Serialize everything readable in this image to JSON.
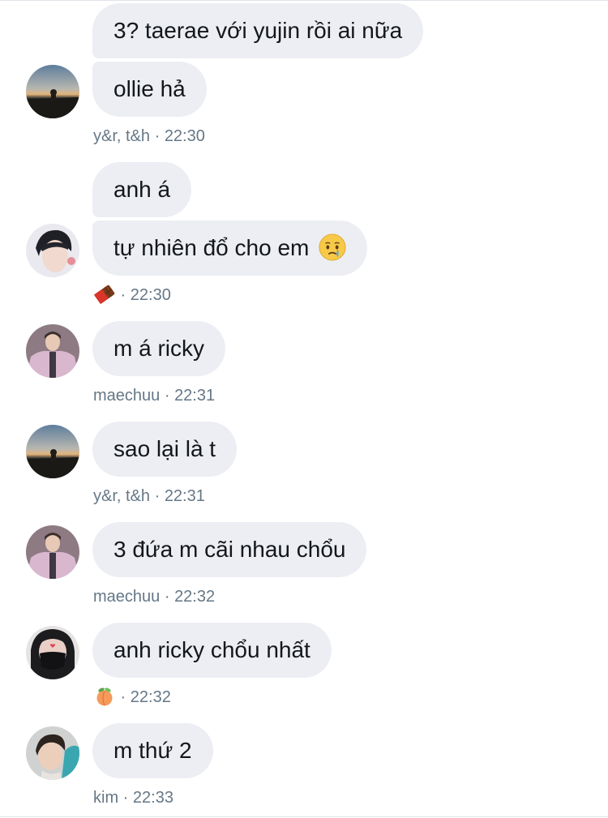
{
  "messages": [
    {
      "text": "3? taerae với yujin rồi ai nữa"
    },
    {
      "text": "ollie hả"
    },
    {
      "text": "anh á"
    },
    {
      "text": "tự nhiên đổ cho em",
      "emoji": "crying-face"
    },
    {
      "text": "m á ricky"
    },
    {
      "text": "sao lại là t"
    },
    {
      "text": "3 đứa m cãi nhau chổu"
    },
    {
      "text": "anh ricky chổu nhất"
    },
    {
      "text": "m thứ 2"
    }
  ],
  "meta": [
    {
      "sender": "y&r, t&h",
      "sep": " · ",
      "time": "22:30"
    },
    {
      "sender_emoji": "chocolate-bar",
      "sep": " · ",
      "time": "22:30"
    },
    {
      "sender": "maechuu",
      "sep": " · ",
      "time": "22:31"
    },
    {
      "sender": "y&r, t&h",
      "sep": " · ",
      "time": "22:31"
    },
    {
      "sender": "maechuu",
      "sep": " · ",
      "time": "22:32"
    },
    {
      "sender_emoji": "peach",
      "sep": " · ",
      "time": "22:32"
    },
    {
      "sender": "kim",
      "sep": " · ",
      "time": "22:33"
    }
  ],
  "colors": {
    "bubble_bg": "#eceef3",
    "text": "#14171a",
    "meta_text": "#657786"
  }
}
